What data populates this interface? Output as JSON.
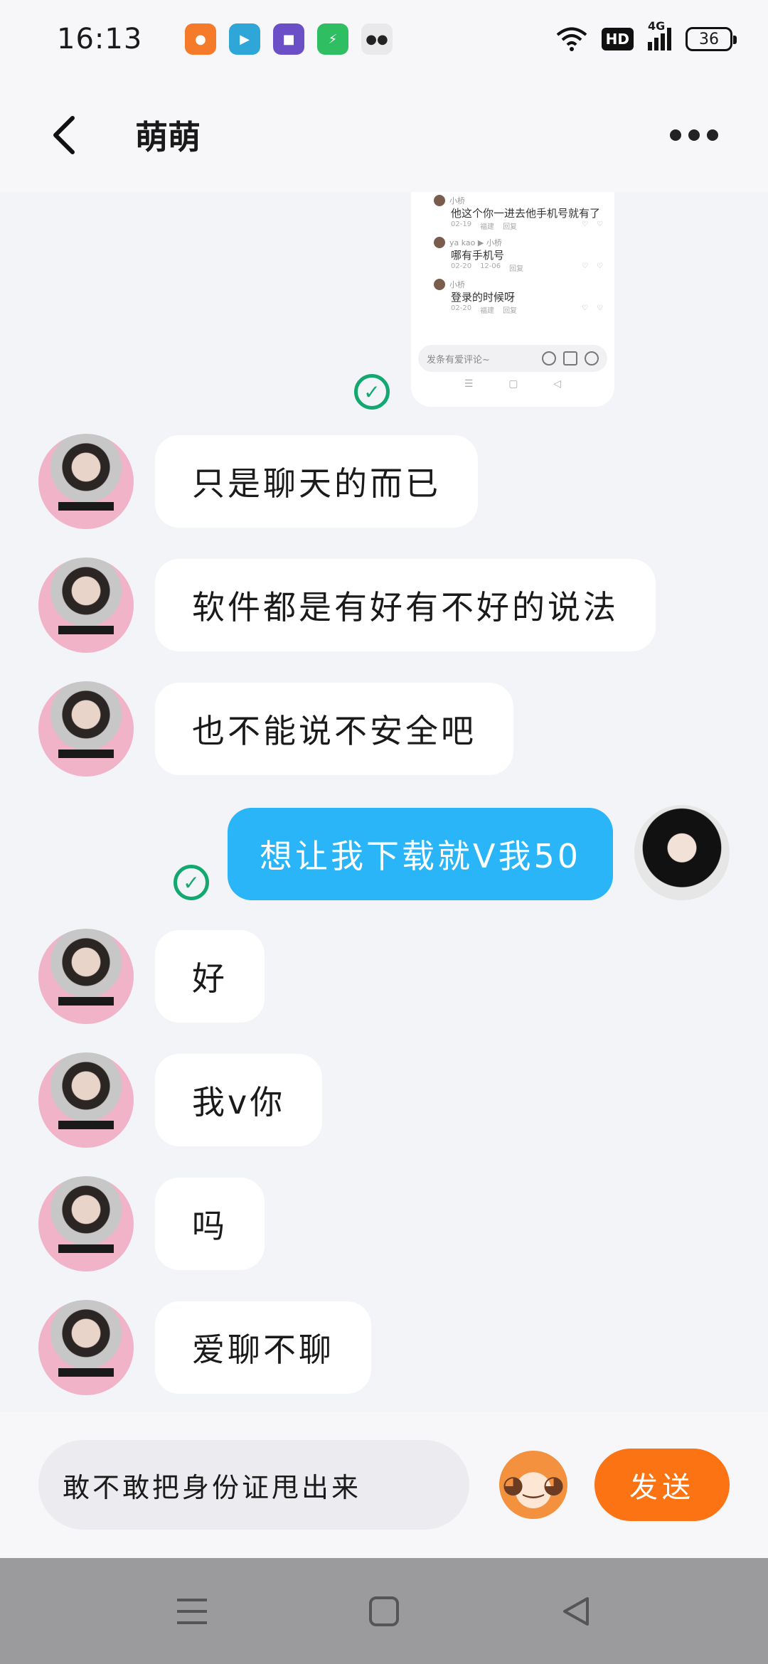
{
  "status_bar": {
    "time": "16:13",
    "network": "4G",
    "hd": "HD",
    "battery": "36",
    "app_icons": [
      "taobao-icon",
      "video-icon",
      "purple-app-icon",
      "green-app-icon",
      "wechat-icon"
    ]
  },
  "header": {
    "title": "萌萌"
  },
  "shared_screenshot": {
    "comments": [
      {
        "user": "小桥",
        "text": "他这个你一进去他手机号就有了",
        "date": "02-19",
        "location": "福建",
        "reply": "回复"
      },
      {
        "user": "ya kao ▶ 小桥",
        "text": "哪有手机号",
        "date": "02-20",
        "location": "12-06",
        "reply": "回复"
      },
      {
        "user": "小桥",
        "text": "登录的时候呀",
        "date": "02-20",
        "location": "福建",
        "reply": "回复"
      }
    ],
    "input_placeholder": "发条有爱评论~"
  },
  "messages": [
    {
      "side": "in",
      "text": "只是聊天的而已"
    },
    {
      "side": "in",
      "text": "软件都是有好有不好的说法"
    },
    {
      "side": "in",
      "text": "也不能说不安全吧"
    },
    {
      "side": "out",
      "text": "想让我下载就V我50"
    },
    {
      "side": "in",
      "text": "好"
    },
    {
      "side": "in",
      "text": "我v你"
    },
    {
      "side": "in",
      "text": "吗"
    },
    {
      "side": "in",
      "text": "爱聊不聊"
    }
  ],
  "composer": {
    "value": "敢不敢把身份证甩出来",
    "send_label": "发送"
  },
  "colors": {
    "outgoing_bubble": "#29b5f7",
    "send_button": "#fb7313",
    "read_check": "#13a86f"
  }
}
